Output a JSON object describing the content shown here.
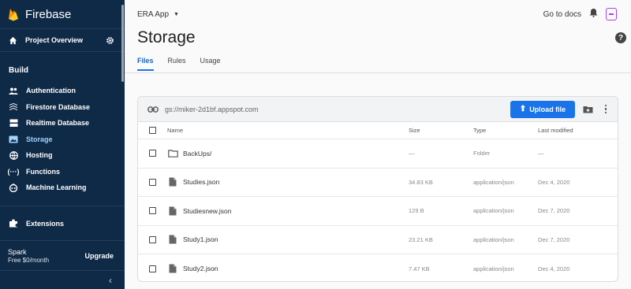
{
  "app": {
    "brand": "Firebase"
  },
  "sidebar": {
    "overview_label": "Project Overview",
    "build_title": "Build",
    "items": [
      {
        "label": "Authentication",
        "icon": "people-icon"
      },
      {
        "label": "Firestore Database",
        "icon": "firestore-icon"
      },
      {
        "label": "Realtime Database",
        "icon": "database-icon"
      },
      {
        "label": "Storage",
        "icon": "image-icon",
        "active": true
      },
      {
        "label": "Hosting",
        "icon": "globe-icon"
      },
      {
        "label": "Functions",
        "icon": "functions-icon"
      },
      {
        "label": "Machine Learning",
        "icon": "robot-icon"
      }
    ],
    "extensions_label": "Extensions",
    "plan_name": "Spark",
    "plan_price": "Free $0/month",
    "upgrade_label": "Upgrade",
    "collapse_glyph": "‹"
  },
  "topbar": {
    "project": "ERA App",
    "docs_label": "Go to docs"
  },
  "page": {
    "title": "Storage",
    "tabs": [
      "Files",
      "Rules",
      "Usage"
    ],
    "help_glyph": "?"
  },
  "storage": {
    "bucket": "gs://miker-2d1bf.appspot.com",
    "upload_label": "Upload file",
    "columns": {
      "name": "Name",
      "size": "Size",
      "type": "Type",
      "modified": "Last modified"
    },
    "rows": [
      {
        "name": "BackUps/",
        "size": "—",
        "type": "Folder",
        "modified": "—",
        "kind": "folder"
      },
      {
        "name": "Studies.json",
        "size": "34.83 KB",
        "type": "application/json",
        "modified": "Dec 4, 2020",
        "kind": "file"
      },
      {
        "name": "Studiesnew.json",
        "size": "129 B",
        "type": "application/json",
        "modified": "Dec 7, 2020",
        "kind": "file"
      },
      {
        "name": "Study1.json",
        "size": "23.21 KB",
        "type": "application/json",
        "modified": "Dec 7, 2020",
        "kind": "file"
      },
      {
        "name": "Study2.json",
        "size": "7.47 KB",
        "type": "application/json",
        "modified": "Dec 4, 2020",
        "kind": "file"
      }
    ]
  },
  "colors": {
    "sidebar_bg": "#0f2a47",
    "accent": "#1a73e8",
    "active_nav": "#a3d3ff"
  }
}
